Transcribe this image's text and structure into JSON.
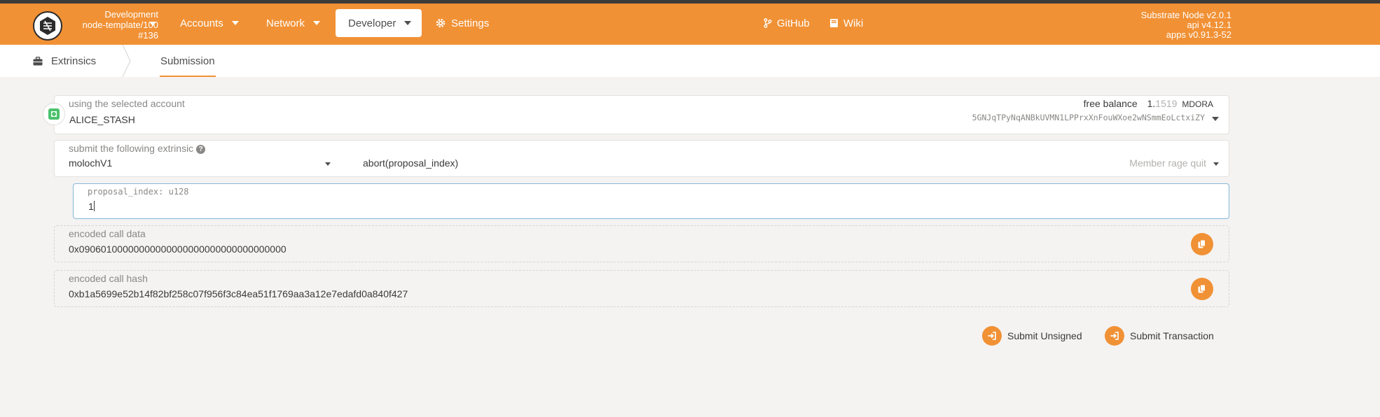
{
  "chain": {
    "name": "Development",
    "runtime": "node-template/100",
    "block": "#136"
  },
  "nav": {
    "accounts": "Accounts",
    "network": "Network",
    "developer": "Developer",
    "settings": "Settings",
    "github": "GitHub",
    "wiki": "Wiki"
  },
  "version": {
    "node": "Substrate Node v2.0.1",
    "api": "api v4.12.1",
    "apps": "apps v0.91.3-52"
  },
  "subnav": {
    "extrinsics": "Extrinsics",
    "submission": "Submission"
  },
  "account": {
    "label": "using the selected account",
    "name": "ALICE_STASH",
    "free_balance_label": "free balance",
    "balance_int": "1.",
    "balance_dec": "1519",
    "balance_unit": "MDORA",
    "address": "5GNJqTPyNqANBkUVMN1LPPrxXnFouWXoe2wNSmmEoLctxiZY"
  },
  "extrinsic": {
    "label": "submit the following extrinsic",
    "module": "molochV1",
    "method": "abort(proposal_index)",
    "doc": "Member rage quit"
  },
  "param": {
    "label": "proposal_index: u128",
    "value": "1"
  },
  "encoded_data": {
    "label": "encoded call data",
    "value": "0x09060100000000000000000000000000000000"
  },
  "encoded_hash": {
    "label": "encoded call hash",
    "value": "0xb1a5699e52b14f82bf258c07f956f3c84ea51f1769aa3a12e7edafd0a840f427"
  },
  "actions": {
    "unsigned": "Submit Unsigned",
    "transaction": "Submit Transaction"
  },
  "colors": {
    "accent": "#f19135",
    "background": "#f4f3f2",
    "focus_border": "#85b7d9"
  },
  "icons": {
    "logo": "substrate-logo-icon",
    "settings": "gear-icon",
    "github": "code-branch-icon",
    "wiki": "book-icon",
    "extrinsics": "briefcase-icon",
    "copy": "copy-icon",
    "submit": "sign-in-icon",
    "help": "question-circle-icon"
  }
}
